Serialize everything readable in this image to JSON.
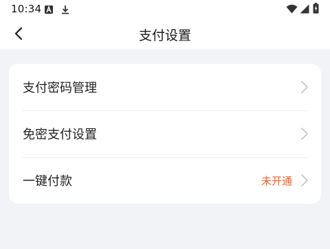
{
  "status_bar": {
    "time": "10:34",
    "icons": [
      "a-notification-icon",
      "download-icon",
      "wifi-icon",
      "signal-icon",
      "battery-icon"
    ]
  },
  "header": {
    "title": "支付设置",
    "back_icon": "chevron-left-icon"
  },
  "settings": {
    "items": [
      {
        "label": "支付密码管理",
        "status": ""
      },
      {
        "label": "免密支付设置",
        "status": ""
      },
      {
        "label": "一键付款",
        "status": "未开通"
      }
    ],
    "chevron_icon": "chevron-right-icon"
  },
  "colors": {
    "background": "#F2F3F7",
    "card": "#FFFFFF",
    "accent": "#F0632F",
    "chevron": "#C4C4C4"
  }
}
